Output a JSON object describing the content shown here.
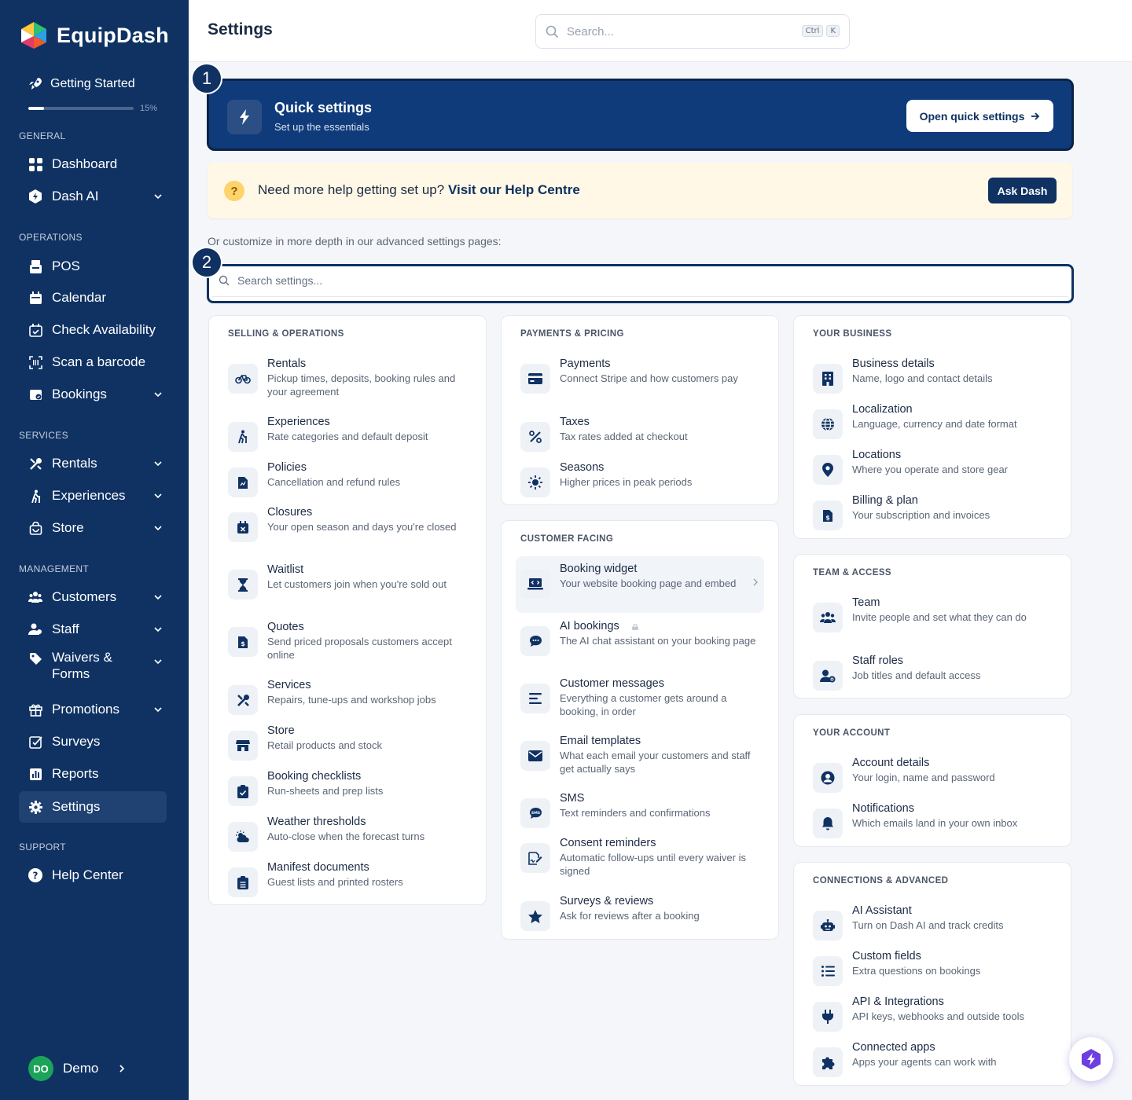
{
  "app": {
    "name": "EquipDash",
    "page_title": "Settings"
  },
  "top_search": {
    "placeholder": "Search...",
    "kbd1": "Ctrl",
    "kbd2": "K"
  },
  "getting_started": {
    "label": "Getting Started",
    "progress_text": "15%",
    "progress": 0.15
  },
  "sidebar": {
    "sections": {
      "general": "GENERAL",
      "operations": "OPERATIONS",
      "services": "SERVICES",
      "management": "MANAGEMENT",
      "support": "SUPPORT"
    },
    "items": {
      "dashboard": "Dashboard",
      "dash_ai": "Dash AI",
      "pos": "POS",
      "calendar": "Calendar",
      "check_availability": "Check Availability",
      "scan_barcode": "Scan a barcode",
      "bookings": "Bookings",
      "rentals": "Rentals",
      "experiences": "Experiences",
      "store": "Store",
      "customers": "Customers",
      "staff": "Staff",
      "waivers_1": "Waivers &",
      "waivers_2": "Forms",
      "promotions": "Promotions",
      "surveys": "Surveys",
      "reports": "Reports",
      "settings": "Settings",
      "help_center": "Help Center"
    },
    "user": {
      "initials": "DO",
      "name": "Demo"
    }
  },
  "annotations": {
    "one": "1",
    "two": "2"
  },
  "quick": {
    "title": "Quick settings",
    "subtitle": "Set up the essentials",
    "button": "Open quick settings"
  },
  "help": {
    "text": "Need more help getting set up?",
    "link": "Visit our Help Centre",
    "icon_text": "?",
    "button": "Ask Dash"
  },
  "advanced_text": "Or customize in more depth in our advanced settings pages:",
  "settings_search": {
    "placeholder": "Search settings..."
  },
  "cards": {
    "selling": {
      "title": "SELLING & OPERATIONS",
      "items": [
        {
          "title": "Rentals",
          "desc": "Pickup times, deposits, booking rules and your agreement"
        },
        {
          "title": "Experiences",
          "desc": "Rate categories and default deposit"
        },
        {
          "title": "Policies",
          "desc": "Cancellation and refund rules"
        },
        {
          "title": "Closures",
          "desc": "Your open season and days you're closed"
        },
        {
          "title": "Waitlist",
          "desc": "Let customers join when you're sold out"
        },
        {
          "title": "Quotes",
          "desc": "Send priced proposals customers accept online"
        },
        {
          "title": "Services",
          "desc": "Repairs, tune-ups and workshop jobs"
        },
        {
          "title": "Store",
          "desc": "Retail products and stock"
        },
        {
          "title": "Booking checklists",
          "desc": "Run-sheets and prep lists"
        },
        {
          "title": "Weather thresholds",
          "desc": "Auto-close when the forecast turns"
        },
        {
          "title": "Manifest documents",
          "desc": "Guest lists and printed rosters"
        }
      ]
    },
    "payments": {
      "title": "PAYMENTS & PRICING",
      "items": [
        {
          "title": "Payments",
          "desc": "Connect Stripe and how customers pay"
        },
        {
          "title": "Taxes",
          "desc": "Tax rates added at checkout"
        },
        {
          "title": "Seasons",
          "desc": "Higher prices in peak periods"
        }
      ]
    },
    "customer": {
      "title": "CUSTOMER FACING",
      "items": [
        {
          "title": "Booking widget",
          "desc": "Your website booking page and embed"
        },
        {
          "title": "AI bookings",
          "desc": "The AI chat assistant on your booking page"
        },
        {
          "title": "Customer messages",
          "desc": "Everything a customer gets around a booking, in order"
        },
        {
          "title": "Email templates",
          "desc": "What each email your customers and staff get actually says"
        },
        {
          "title": "SMS",
          "desc": "Text reminders and confirmations"
        },
        {
          "title": "Consent reminders",
          "desc": "Automatic follow-ups until every waiver is signed"
        },
        {
          "title": "Surveys & reviews",
          "desc": "Ask for reviews after a booking"
        }
      ]
    },
    "business": {
      "title": "YOUR BUSINESS",
      "items": [
        {
          "title": "Business details",
          "desc": "Name, logo and contact details"
        },
        {
          "title": "Localization",
          "desc": "Language, currency and date format"
        },
        {
          "title": "Locations",
          "desc": "Where you operate and store gear"
        },
        {
          "title": "Billing & plan",
          "desc": "Your subscription and invoices"
        }
      ]
    },
    "team": {
      "title": "TEAM & ACCESS",
      "items": [
        {
          "title": "Team",
          "desc": "Invite people and set what they can do"
        },
        {
          "title": "Staff roles",
          "desc": "Job titles and default access"
        }
      ]
    },
    "account": {
      "title": "YOUR ACCOUNT",
      "items": [
        {
          "title": "Account details",
          "desc": "Your login, name and password"
        },
        {
          "title": "Notifications",
          "desc": "Which emails land in your own inbox"
        }
      ]
    },
    "connections": {
      "title": "CONNECTIONS & ADVANCED",
      "items": [
        {
          "title": "AI Assistant",
          "desc": "Turn on Dash AI and track credits"
        },
        {
          "title": "Custom fields",
          "desc": "Extra questions on bookings"
        },
        {
          "title": "API & Integrations",
          "desc": "API keys, webhooks and outside tools"
        },
        {
          "title": "Connected apps",
          "desc": "Apps your agents can work with"
        }
      ]
    }
  },
  "colors": {
    "sidebar": "#0f3263",
    "accent": "#0f3b7a",
    "help_bg": "#fff8e6",
    "avatar": "#1ca35a"
  }
}
